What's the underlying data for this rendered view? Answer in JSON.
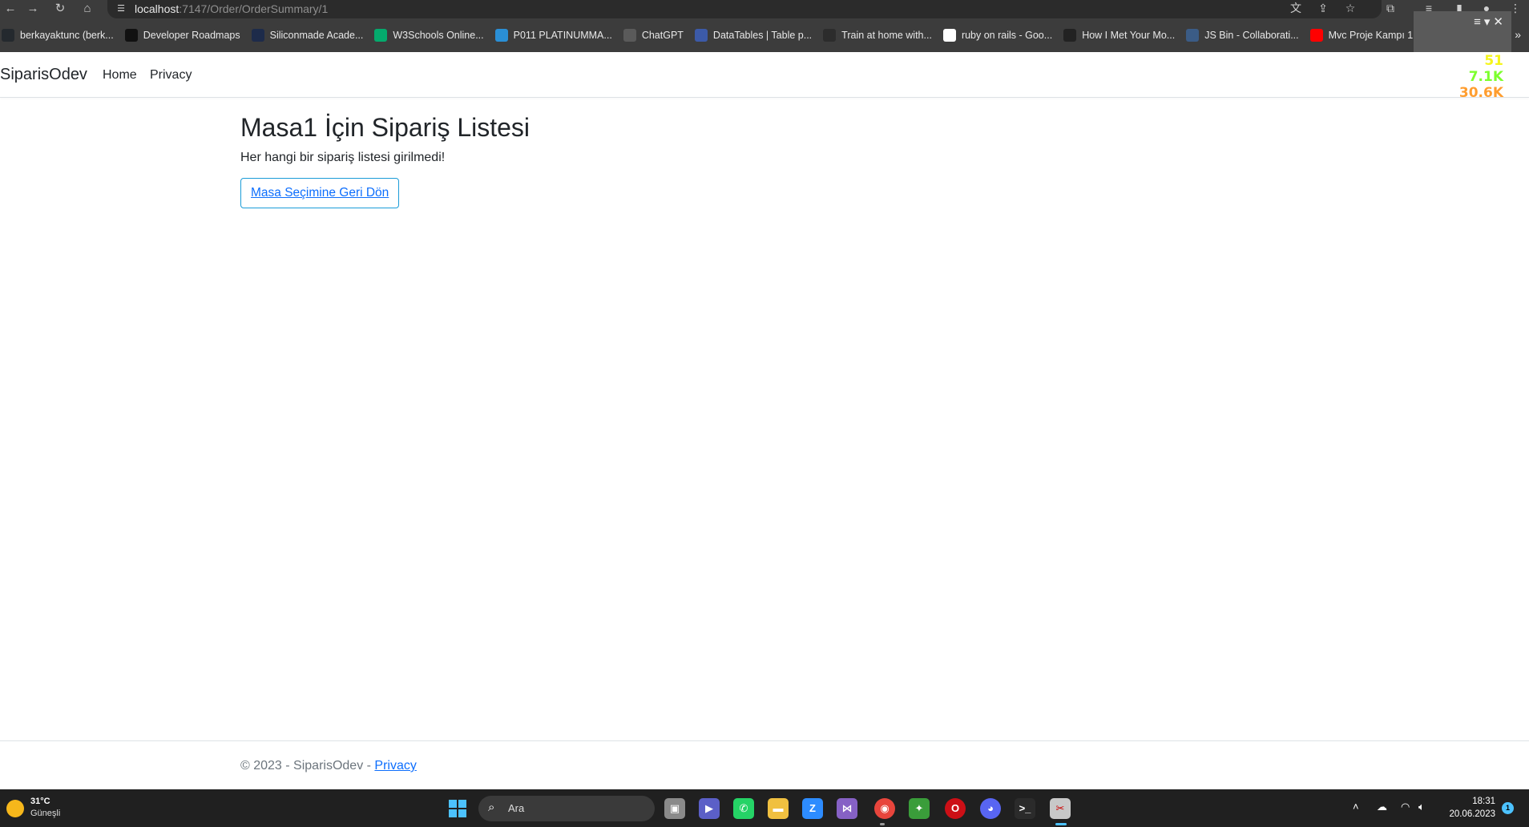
{
  "browser": {
    "url_host": "localhost",
    "url_path": ":7147/Order/OrderSummary/1",
    "bookmarks": [
      {
        "label": "berkayaktunc (berk...",
        "icon": "github-icon",
        "color": "#24292e"
      },
      {
        "label": "Developer Roadmaps",
        "icon": "roadmap-icon",
        "color": "#111111"
      },
      {
        "label": "Siliconmade Acade...",
        "icon": "siliconmade-icon",
        "color": "#1d2b4a"
      },
      {
        "label": "W3Schools Online...",
        "icon": "w3schools-icon",
        "color": "#04aa6d"
      },
      {
        "label": "P011 PLATINUMMA...",
        "icon": "image-icon",
        "color": "#2a8fd6"
      },
      {
        "label": "ChatGPT",
        "icon": "chatgpt-icon",
        "color": "#5a5a5a"
      },
      {
        "label": "DataTables | Table p...",
        "icon": "datatables-icon",
        "color": "#3c5aa8"
      },
      {
        "label": "Train at home with...",
        "icon": "circle-icon",
        "color": "#2c2c2c"
      },
      {
        "label": "ruby on rails - Goo...",
        "icon": "google-icon",
        "color": "#ffffff"
      },
      {
        "label": "How I Met Your Mo...",
        "icon": "robot-icon",
        "color": "#222222"
      },
      {
        "label": "JS Bin - Collaborati...",
        "icon": "jsbin-icon",
        "color": "#3b5c86"
      },
      {
        "label": "Mvc Proje Kampı 1...",
        "icon": "youtube-icon",
        "color": "#ff0000"
      }
    ]
  },
  "widget": {
    "values": [
      "51",
      "7.1K",
      "30.6K"
    ],
    "colors": [
      "#f5f51b",
      "#7dff2e",
      "#ff9d2e"
    ]
  },
  "navbar": {
    "brand": "SiparisOdev",
    "links": [
      "Home",
      "Privacy"
    ]
  },
  "main": {
    "title": "Masa1 İçin Sipariş Listesi",
    "message": "Her hangi bir sipariş listesi girilmedi!",
    "back_button": "Masa Seçimine Geri Dön"
  },
  "footer": {
    "text": "© 2023 - SiparisOdev - ",
    "link": "Privacy"
  },
  "taskbar": {
    "weather_temp": "31°C",
    "weather_desc": "Güneşli",
    "search_placeholder": "Ara",
    "time": "18:31",
    "date": "20.06.2023",
    "notification_count": "1"
  }
}
